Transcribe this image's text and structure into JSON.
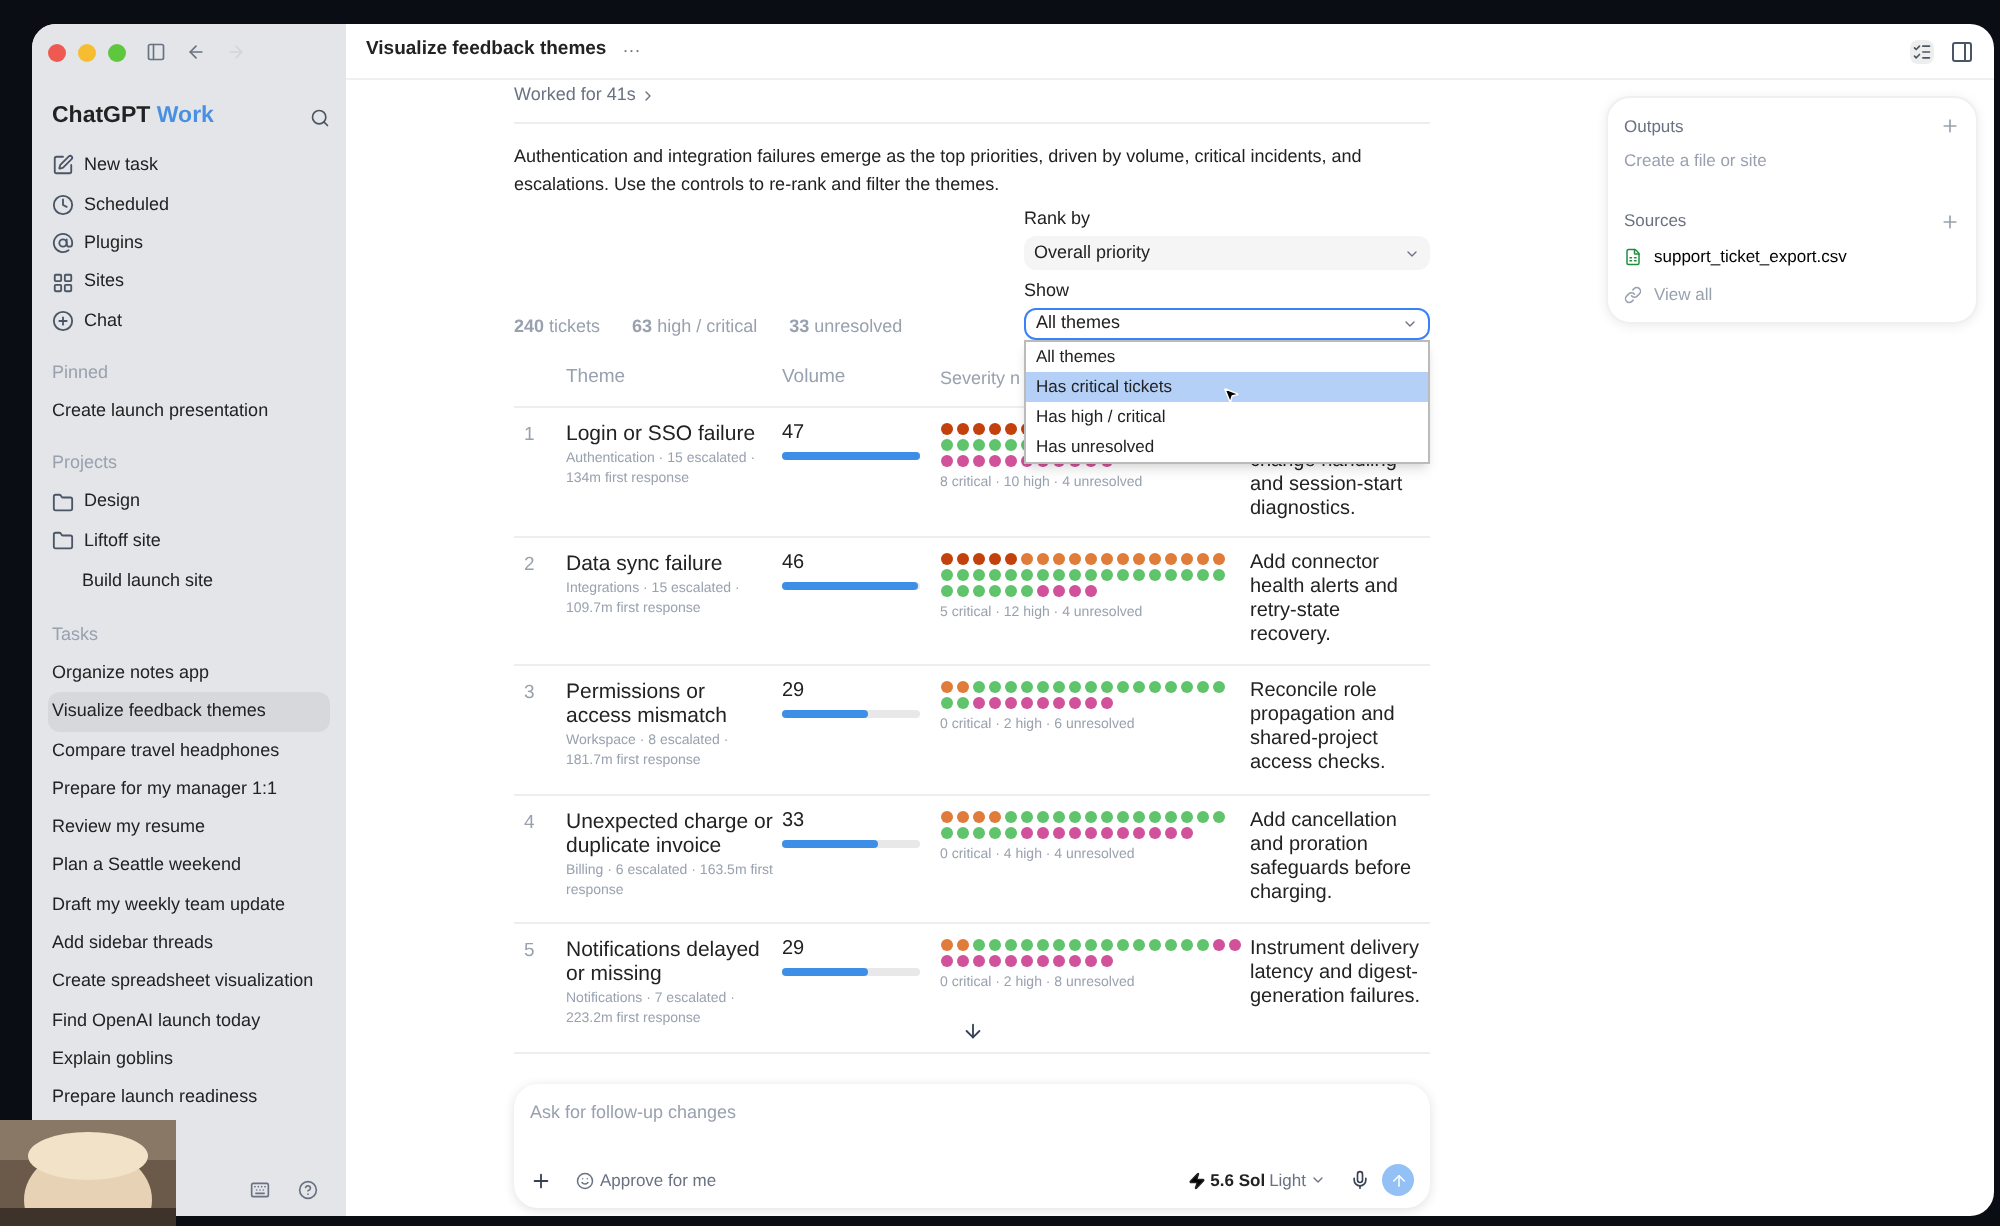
{
  "sidebar": {
    "brand": "ChatGPT",
    "brand_accent": "Work",
    "nav": [
      {
        "label": "New task"
      },
      {
        "label": "Scheduled"
      },
      {
        "label": "Plugins"
      },
      {
        "label": "Sites"
      },
      {
        "label": "Chat"
      }
    ],
    "sections": [
      {
        "title": "Pinned",
        "items": [
          {
            "label": "Create launch presentation",
            "selected": false
          }
        ]
      },
      {
        "title": "Projects",
        "items": [
          {
            "label": "Design",
            "kind": "folder",
            "selected": false
          },
          {
            "label": "Liftoff site",
            "kind": "folder",
            "selected": false,
            "children": [
              {
                "label": "Build launch site",
                "selected": false
              }
            ]
          }
        ]
      },
      {
        "title": "Tasks",
        "items": [
          {
            "label": "Organize notes app",
            "selected": false
          },
          {
            "label": "Visualize feedback themes",
            "selected": true
          },
          {
            "label": "Compare travel headphones",
            "selected": false
          },
          {
            "label": "Prepare for my manager 1:1",
            "selected": false
          },
          {
            "label": "Review my resume",
            "selected": false
          },
          {
            "label": "Plan a Seattle weekend",
            "selected": false
          },
          {
            "label": "Draft my weekly team update",
            "selected": false
          },
          {
            "label": "Add sidebar threads",
            "selected": false
          },
          {
            "label": "Create spreadsheet visualization",
            "selected": false
          },
          {
            "label": "Find OpenAI launch today",
            "selected": false
          },
          {
            "label": "Explain goblins",
            "selected": false
          },
          {
            "label": "Prepare launch readiness",
            "selected": false
          }
        ]
      }
    ]
  },
  "header": {
    "title": "Visualize feedback themes",
    "more": "···"
  },
  "worked": "Worked for 41s",
  "summary": "Authentication and integration failures emerge as the top priorities, driven by volume, critical incidents, and escalations. Use the controls to re-rank and filter the themes.",
  "controls": {
    "rank_label": "Rank by",
    "rank_value": "Overall priority",
    "show_label": "Show",
    "show_value": "All themes",
    "show_options": [
      {
        "label": "All themes",
        "selected": false
      },
      {
        "label": "Has critical tickets",
        "selected": true
      },
      {
        "label": "Has high / critical",
        "selected": false
      },
      {
        "label": "Has unresolved",
        "selected": false
      }
    ]
  },
  "stats": [
    "**240** tickets",
    "**63** high / critical",
    "**33** unresolved"
  ],
  "table": {
    "columns": [
      "Theme",
      "Volume",
      "Severity n"
    ],
    "rows": [
      {
        "rank": "1",
        "theme": "Login or SSO failure",
        "meta": "Authentication · 15 escalated · 134m first response",
        "volume": "47",
        "level": 1,
        "severity": "8 critical · 10 high · 4 unresolved",
        "action": "change handling and session-start diagnostics."
      },
      {
        "rank": "2",
        "theme": "Data sync failure",
        "meta": "Integrations · 15 escalated · 109.7m first response",
        "volume": "46",
        "level": 0.98,
        "severity": "5 critical · 12 high · 4 unresolved",
        "action": "Add connector health alerts and retry-state recovery."
      },
      {
        "rank": "3",
        "theme": "Permissions or access mismatch",
        "meta": "Workspace · 8 escalated · 181.7m first response",
        "volume": "29",
        "level": 0.62,
        "severity": "0 critical · 2 high · 6 unresolved",
        "action": "Reconcile role propagation and shared-project access checks."
      },
      {
        "rank": "4",
        "theme": "Unexpected charge or duplicate invoice",
        "meta": "Billing · 6 escalated · 163.5m first response",
        "volume": "33",
        "level": 0.7,
        "severity": "0 critical · 4 high · 4 unresolved",
        "action": "Add cancellation and proration safeguards before charging."
      },
      {
        "rank": "5",
        "theme": "Notifications delayed or missing",
        "meta": "Notifications · 7 escalated · 223.2m first response",
        "volume": "29",
        "level": 0.62,
        "severity": "0 critical · 2 high · 8 unresolved",
        "action": "Instrument delivery latency and digest-generation failures."
      }
    ]
  },
  "composer": {
    "placeholder": "Ask for follow-up changes",
    "approve": "Approve for me",
    "model": "5.6 Sol",
    "effort": "Light"
  },
  "panel": {
    "outputs_title": "Outputs",
    "outputs_hint": "Create a file or site",
    "sources_title": "Sources",
    "files": [
      {
        "name": "support_ticket_export.csv"
      }
    ],
    "view_all": "View all"
  }
}
